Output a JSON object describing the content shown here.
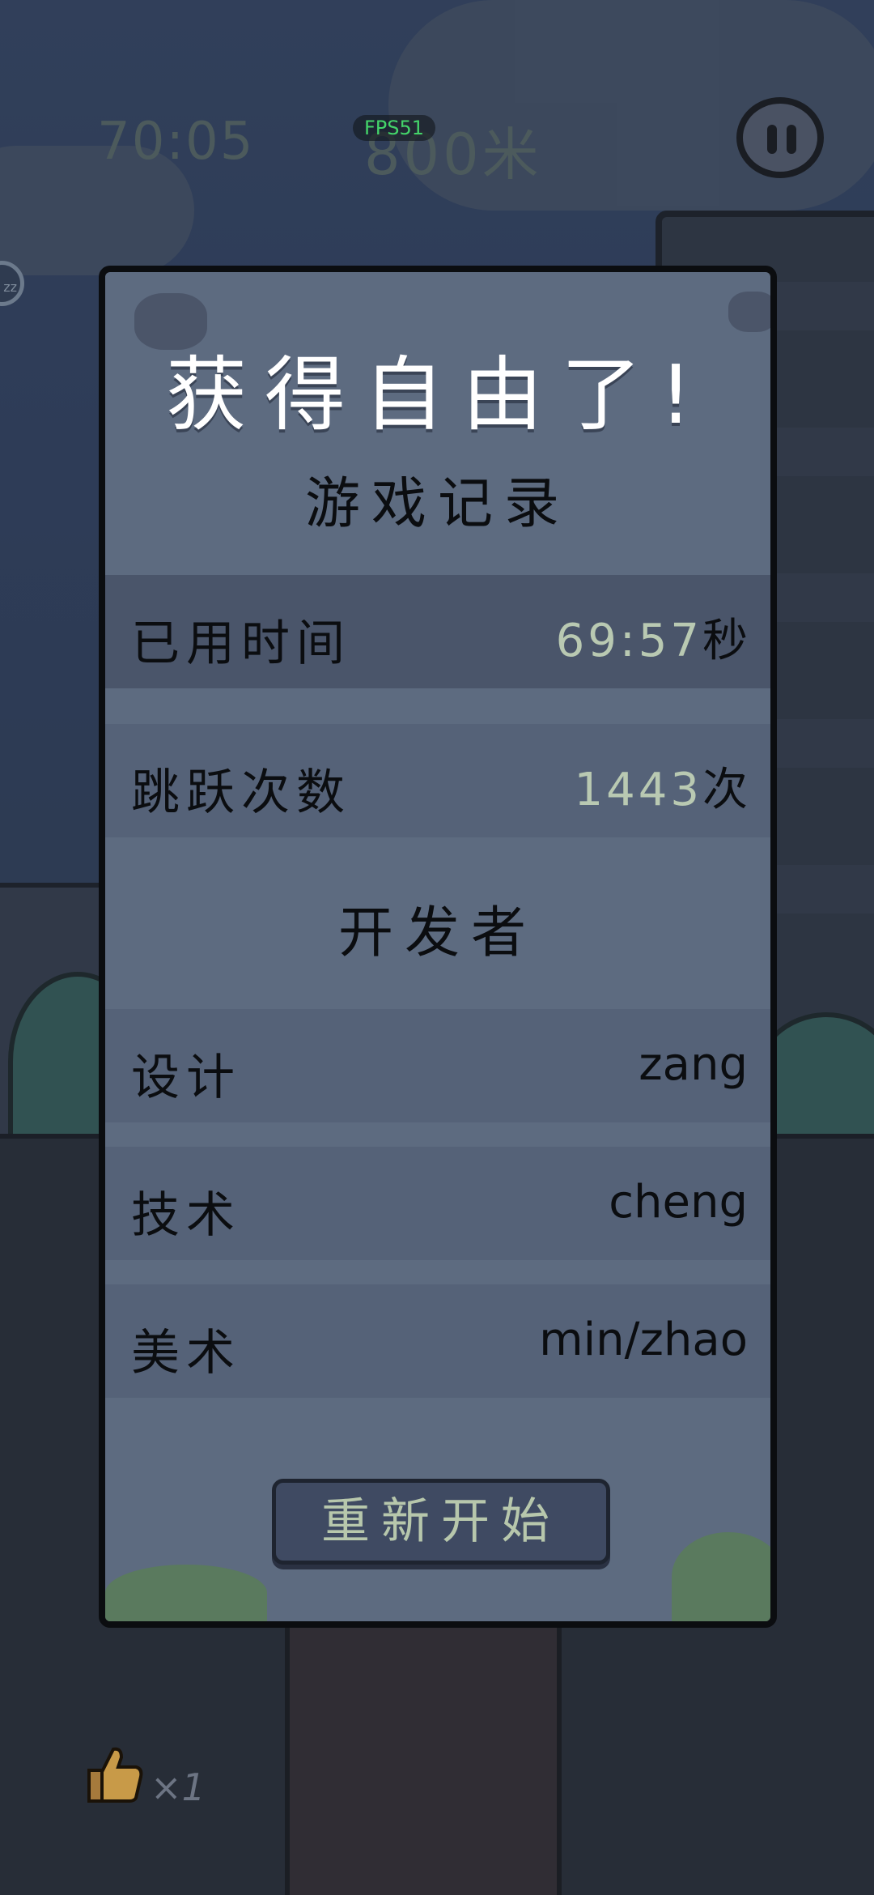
{
  "hud": {
    "time": "70:05",
    "distance": "800米",
    "fps": "FPS51",
    "left_badge": "zz",
    "like_count": "×1"
  },
  "dialog": {
    "title": "获得自由了!",
    "record_section": "游戏记录",
    "elapsed_time_label": "已用时间",
    "elapsed_time_value": "69:57",
    "elapsed_time_unit": "秒",
    "jumps_label": "跳跃次数",
    "jumps_value": "1443",
    "jumps_unit": "次",
    "developers_section": "开发者",
    "credits": [
      {
        "role": "设计",
        "name": "zang"
      },
      {
        "role": "技术",
        "name": "cheng"
      },
      {
        "role": "美术",
        "name": "min/zhao"
      }
    ],
    "restart_label": "重新开始"
  },
  "colors": {
    "dialog_bg": "#5d6b80",
    "row_bg": "#556278",
    "highlight_row_bg": "#4a556a",
    "number_color": "#b9c9b2",
    "fps_color": "#44d46a",
    "button_bg": "#3f4a62"
  },
  "icons": {
    "pause": "pause-icon",
    "like": "thumbs-up-icon"
  }
}
